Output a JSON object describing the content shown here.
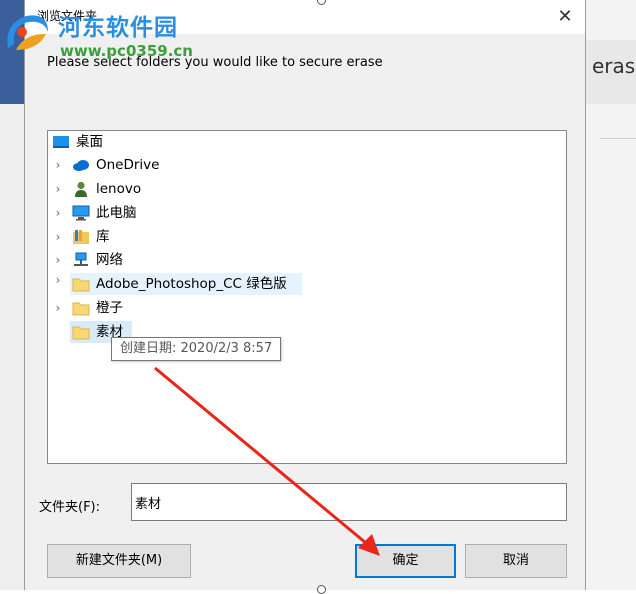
{
  "background_app": {
    "partial_text": "erase"
  },
  "watermark": {
    "site_name": "河东软件园",
    "url": "www.pc0359.cn"
  },
  "dialog": {
    "title": "浏览文件夹",
    "close_glyph": "✕",
    "prompt": "Please select folders you would like to secure erase",
    "tree": [
      {
        "label": "桌面",
        "icon": "desktop-icon",
        "expandable": false
      },
      {
        "label": "OneDrive",
        "icon": "cloud-icon",
        "expandable": true
      },
      {
        "label": "lenovo",
        "icon": "user-icon",
        "expandable": true
      },
      {
        "label": "此电脑",
        "icon": "computer-icon",
        "expandable": true
      },
      {
        "label": "库",
        "icon": "library-icon",
        "expandable": true
      },
      {
        "label": "网络",
        "icon": "network-icon",
        "expandable": true
      },
      {
        "label": "Adobe_Photoshop_CC  绿色版",
        "icon": "folder-icon",
        "expandable": true
      },
      {
        "label": "橙子",
        "icon": "folder-icon",
        "expandable": true
      },
      {
        "label": "素材",
        "icon": "folder-icon",
        "expandable": false
      }
    ],
    "tooltip": "创建日期: 2020/2/3 8:57",
    "folder_label": "文件夹(F):",
    "folder_value": "素材",
    "buttons": {
      "new_folder": "新建文件夹(M)",
      "ok": "确定",
      "cancel": "取消"
    }
  },
  "colors": {
    "accent": "#0078d7",
    "annotation_arrow": "#e8261c",
    "folder_yellow": "#f8d775"
  }
}
